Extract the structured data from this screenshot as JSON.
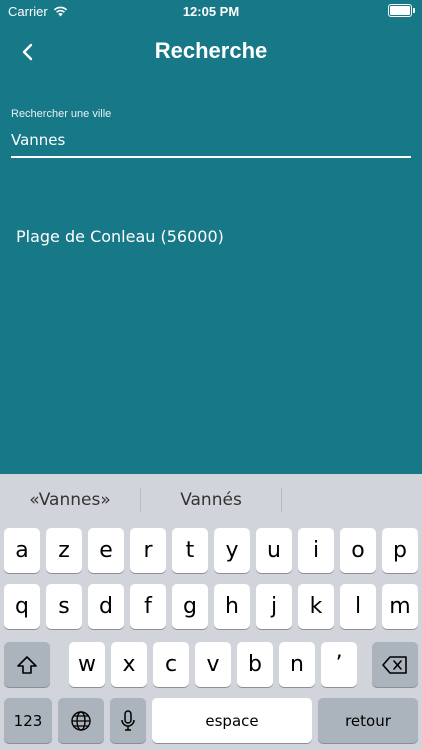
{
  "status_bar": {
    "carrier": "Carrier",
    "time": "12:05 PM"
  },
  "nav": {
    "title": "Recherche"
  },
  "search": {
    "label": "Rechercher une ville",
    "value": "Vannes"
  },
  "results": [
    {
      "label": "Plage de Conleau (56000)"
    }
  ],
  "keyboard": {
    "suggestions": [
      "«Vannes»",
      "Vannés",
      ""
    ],
    "row1": [
      "a",
      "z",
      "e",
      "r",
      "t",
      "y",
      "u",
      "i",
      "o",
      "p"
    ],
    "row2": [
      "q",
      "s",
      "d",
      "f",
      "g",
      "h",
      "j",
      "k",
      "l",
      "m"
    ],
    "row3": [
      "w",
      "x",
      "c",
      "v",
      "b",
      "n",
      "’"
    ],
    "numbers_label": "123",
    "space_label": "espace",
    "return_label": "retour"
  },
  "colors": {
    "background": "#177888",
    "keyboard": "#d1d5db"
  }
}
